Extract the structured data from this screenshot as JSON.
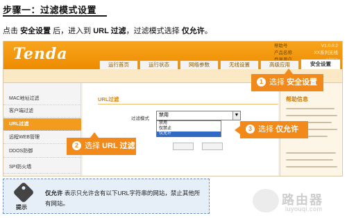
{
  "step": {
    "title": "步骤一：过滤模式设置"
  },
  "intro": {
    "p1": "点击 ",
    "b1": "安全设置",
    "p2": " 后，进入到 ",
    "b2": "URL 过滤",
    "p3": "，过滤模式选择 ",
    "b3": "仅允许",
    "p4": "。"
  },
  "router": {
    "logo": "Tenda",
    "info": [
      {
        "label": "帮助号",
        "value": "V1.0.0.2"
      },
      {
        "label": "产品名称",
        "value": "XX系列无线"
      },
      {
        "label": "登录用户",
        "value": "admin"
      }
    ],
    "tabs": [
      "运行首页",
      "运行状态",
      "网络参数",
      "无线设置",
      "高级应用",
      "安全设置"
    ],
    "active_tab": "安全设置",
    "sidebar": [
      "MAC地址过滤",
      "客户端过滤",
      "URL过滤",
      "远程WEB管理",
      "DDOS防御",
      "SPI防火墙"
    ],
    "active_menu": "URL过滤",
    "content": {
      "title": "URL过滤",
      "mode_label": "过滤模式",
      "select_value": "禁用",
      "options": [
        "禁用",
        "仅禁止",
        "仅允许"
      ],
      "selected_option": "仅允许"
    },
    "help": {
      "title": "帮助信息"
    }
  },
  "callouts": [
    {
      "num": "1",
      "pre": "选择 ",
      "bold": "安全设置"
    },
    {
      "num": "2",
      "pre": "选择 ",
      "bold": "URL 过滤"
    },
    {
      "num": "3",
      "pre": "选择 ",
      "bold": "仅允许"
    }
  ],
  "tip": {
    "label": "提示",
    "bold": "仅允许",
    "text": " 表示只允许含有以下URL字符串的网站，禁止其他所有网站。"
  },
  "watermark": {
    "cn": "路由器",
    "en": "luyouqi.com"
  },
  "colors": {
    "accent": "#f18a1a",
    "tip_border": "#6a8fc0",
    "dropdown_highlight": "#3169c6"
  }
}
